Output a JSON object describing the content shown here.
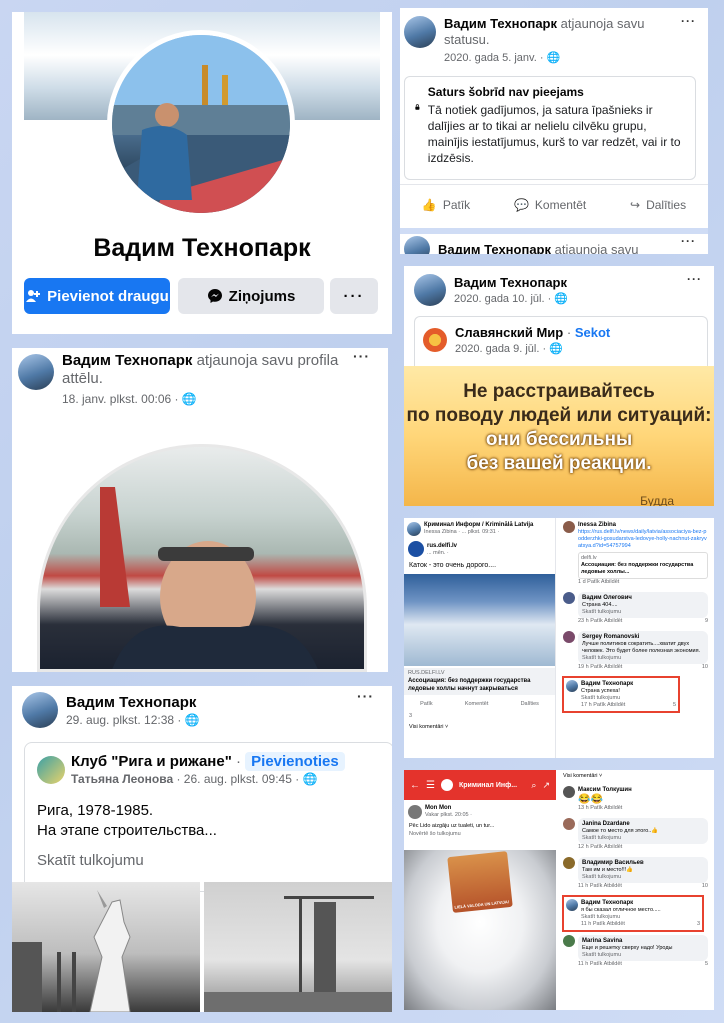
{
  "profile": {
    "name": "Вадим Технопарк",
    "add_friend": "Pievienot draugu",
    "message": "Ziņojums",
    "more": "···"
  },
  "profile_pic_post": {
    "author": "Вадим Технопарк",
    "action": "atjaunoja savu profila attēlu.",
    "time": "18. janv. plkst. 00:06 ·"
  },
  "club_post": {
    "author": "Вадим Технопарк",
    "time": "29. aug. plkst. 12:38 ·",
    "group": "Клуб \"Рига и рижане\"",
    "join": "Pievienoties",
    "poster": "Татьяна Леонова",
    "poster_time": "· 26. aug. plkst. 09:45 ·",
    "text1": "Рига, 1978-1985.",
    "text2": "На этапе строительства...",
    "translate": "Skatīt tulkojumu"
  },
  "status_post": {
    "author": "Вадим Технопарк",
    "action": "atjaunoja savu",
    "action2": "statusu.",
    "time": "2020. gada 5. janv. ·",
    "notice_title": "Saturs šobrīd nav pieejams",
    "notice_text": "Tā notiek gadījumos, ja satura īpašnieks ir dalījies ar to tikai ar nelielu cilvēku grupu, mainījis iestatījumus, kurš to var redzēt, vai ir to izdzēsis.",
    "like": "Patīk",
    "comment": "Komentēt",
    "share": "Dalīties",
    "next_author": "Вадим Технопарк",
    "next_action": "atjaunoja savu"
  },
  "slavic_post": {
    "author": "Вадим Технопарк",
    "time": "2020. gada 10. jūl. ·",
    "page": "Славянский Мир",
    "follow": "Sekot",
    "page_time": "2020. gada 9. jūl. ·",
    "quote1": "Не расстраивайтесь",
    "quote2": "по поводу людей или ситуаций:",
    "quote3": "они бессильны",
    "quote4": "без вашей реакции.",
    "quote_author": "Будда"
  },
  "crime_post": {
    "group": "Криминал Информ / Kriminālā Latvija",
    "sub": "Inessa Zibina · ... plkst. 09:31 ·",
    "source": "rus.delfi.lv",
    "source_sub": "... mēn. ·",
    "text": "Каток - это очень дорого....",
    "link_domain": "RUS.DELFI.LV",
    "link_title": "Ассоциация: без поддержки государства ледовые холлы начнут закрываться",
    "like": "Patīk",
    "comment": "Komentēt",
    "share": "Dalīties",
    "reactions": "3",
    "comments_all": "Visi komentāri ˅",
    "c1_author": "Inessa Zibina",
    "c1_link": "https://rus.delfi.lv/news/daily/latvia/associaciya-bez-podderzhki-gosudarstva-ledovye-holly-nachnut-zakryvatsya.d?id=54757994",
    "c1_card_domain": "delfi.lv",
    "c1_card_text": "Ассоциация: без поддержки государства ледовые холлы...",
    "c1_time": "1 d   Patīk   Atbildēt",
    "c2_author": "Вадим Олегович",
    "c2_text": "Страна 404....",
    "c2_tr": "Skatīt tulkojumu",
    "c2_time": "23 h   Patīk   Atbildēt",
    "c2_reacts": "9",
    "c3_author": "Sergey Romanovski",
    "c3_text": "Лучше политиков сократить....хватит двух человек. Это будет более полезная экономия.",
    "c3_tr": "Skatīt tulkojumu",
    "c3_time": "19 h   Patīk   Atbildēt",
    "c3_reacts": "10",
    "c4_author": "Вадим Технопарк",
    "c4_text": "Страна успеха!",
    "c4_tr": "Skatīt tulkojumu",
    "c4_time": "17 h   Patīk   Atbildēt",
    "c4_reacts": "5"
  },
  "toilet_post": {
    "bar_title": "Криминал Инф...",
    "author": "Mon Mon",
    "author_sub": "Vakar plkst. 20:05 ·",
    "text": "Pēc Lido aizgāju uz tualeti, un tur...",
    "translate": "Novērtē šo tulkojumu",
    "poster_text": "LIELĀ VALODA UN LATVIJA!",
    "comments_all": "Visi komentāri ˅",
    "c1_author": "Максим Толкушин",
    "c1_text": "😂😂",
    "c1_time": "13 h   Patīk   Atbildēt",
    "c2_author": "Janina Dzardane",
    "c2_text": "Самое то место для этого..👍",
    "c2_tr": "Skatīt tulkojumu",
    "c2_time": "12 h   Patīk   Atbildēt",
    "c3_author": "Владимир Васильев",
    "c3_text": "Там им и место!!!👍",
    "c3_tr": "Skatīt tulkojumu",
    "c3_time": "11 h   Patīk   Atbildēt",
    "c3_reacts": "10",
    "c4_author": "Вадим Технопарк",
    "c4_text": "я бы сказал отличное место.....",
    "c4_tr": "Skatīt tulkojumu",
    "c4_time": "11 h   Patīk   Atbildēt",
    "c4_reacts": "3",
    "c5_author": "Marina Savina",
    "c5_text": "Еще и решетку сверху надо! Уроды",
    "c5_tr": "Skatīt tulkojumu",
    "c5_time": "11 h   Patīk   Atbildēt",
    "c5_reacts": "5"
  },
  "colors": {
    "fb_blue": "#1877f2",
    "highlight_red": "#e8422f",
    "bar_red": "#e4332c"
  }
}
